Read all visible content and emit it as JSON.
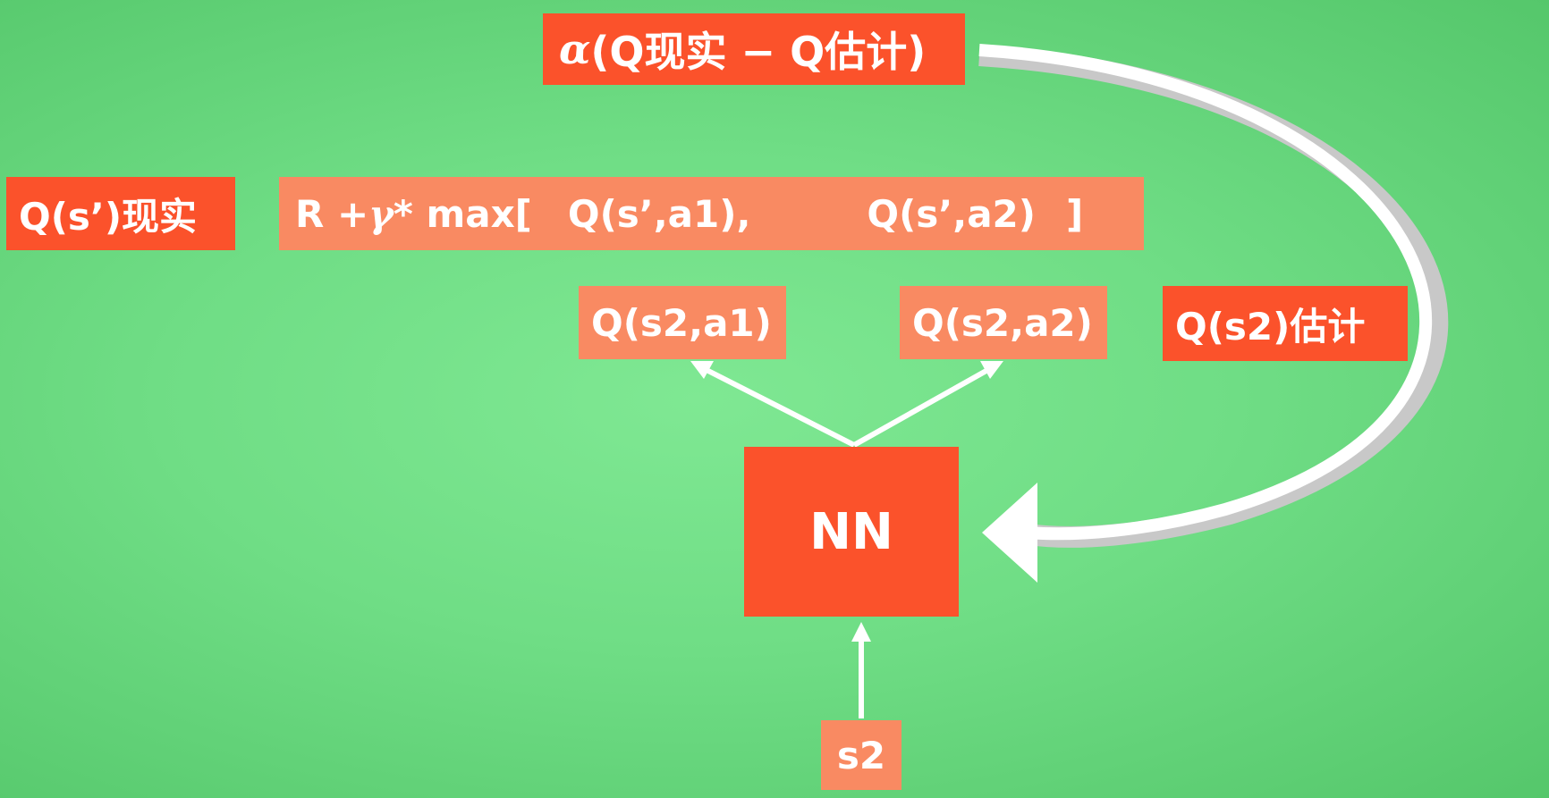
{
  "diagram": {
    "update_label": {
      "greek": "α",
      "text": "(Q现实 − Q估计)"
    },
    "q_real_label": "Q(s’)现实",
    "formula": {
      "prefix": "R + ",
      "greek": "γ",
      "suffix": "* max[",
      "term1": "Q(s’,a1),",
      "term2": "Q(s’,a2)",
      "close": "]"
    },
    "q_s2_a1": "Q(s2,a1)",
    "q_s2_a2": "Q(s2,a2)",
    "q_estimate_label": "Q(s2)估计",
    "nn_label": "NN",
    "input_label": "s2"
  },
  "colors": {
    "background": "#70de86",
    "box_dark": "#fb522b",
    "box_light": "#f98a62",
    "arrows": "#ffffff",
    "curve_shadow": "#cfcfcf"
  }
}
